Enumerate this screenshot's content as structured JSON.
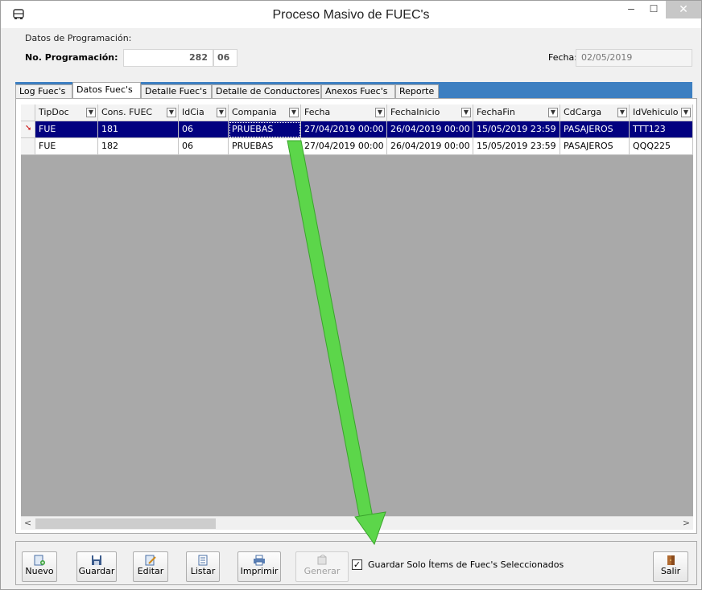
{
  "window": {
    "title": "Proceso Masivo de FUEC's",
    "minimize": "–",
    "maximize": "☐",
    "close": "✕"
  },
  "header": {
    "section_label": "Datos de Programación:",
    "prog_label": "No. Programación:",
    "prog_value": "282",
    "prog_sub": "06",
    "fecha_label": "Fecha:",
    "fecha_value": "02/05/2019"
  },
  "tabs": [
    "Log Fuec's",
    "Datos Fuec's",
    "Detalle Fuec's",
    "Detalle de Conductores",
    "Anexos Fuec's",
    "Reporte"
  ],
  "active_tab": "Datos Fuec's",
  "grid": {
    "columns": [
      "TipDoc",
      "Cons. FUEC",
      "IdCia",
      "Compania",
      "Fecha",
      "FechaInicio",
      "FechaFin",
      "CdCarga",
      "IdVehiculo"
    ],
    "rows": [
      [
        "FUE",
        "181",
        "06",
        "PRUEBAS",
        "27/04/2019 00:00",
        "26/04/2019 00:00",
        "15/05/2019 23:59",
        "PASAJEROS",
        "TTT123"
      ],
      [
        "FUE",
        "182",
        "06",
        "PRUEBAS",
        "27/04/2019 00:00",
        "26/04/2019 00:00",
        "15/05/2019 23:59",
        "PASAJEROS",
        "QQQ225"
      ]
    ],
    "selected_row": 0,
    "selected_color": "#020180"
  },
  "toolbar": {
    "nuevo": "Nuevo",
    "guardar": "Guardar",
    "editar": "Editar",
    "listar": "Listar",
    "imprimir": "Imprimir",
    "generar": "Generar",
    "salir": "Salir"
  },
  "checkbox": {
    "label": "Guardar Solo Ítems de Fuec's Seleccionados",
    "checked": true
  },
  "colors": {
    "tab_strip": "#3d7fc1",
    "grid_bg": "#a9a9a9",
    "arrow": "#5cd64a"
  }
}
